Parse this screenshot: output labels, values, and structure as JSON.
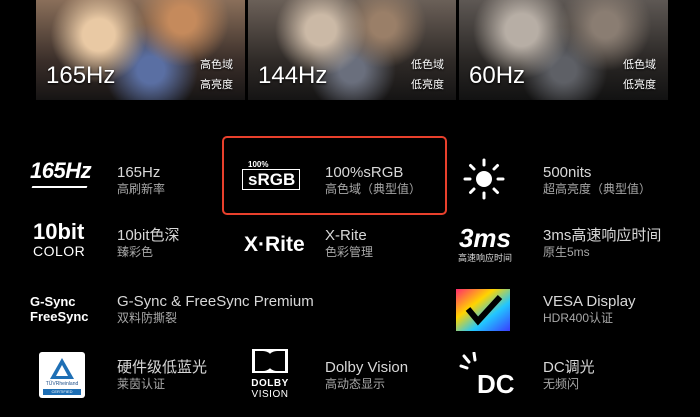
{
  "comparison": [
    {
      "hz": "165Hz",
      "tag1": "高色域",
      "tag2": "高亮度"
    },
    {
      "hz": "144Hz",
      "tag1": "低色域",
      "tag2": "低亮度"
    },
    {
      "hz": "60Hz",
      "tag1": "低色域",
      "tag2": "低亮度"
    }
  ],
  "features": {
    "hz165": {
      "logo": "165Hz",
      "title": "165Hz",
      "sub": "高刷新率"
    },
    "srgb": {
      "logo_top": "100%",
      "logo_main": "sRGB",
      "title": "100%sRGB",
      "sub": "高色域（典型值）"
    },
    "nits": {
      "title": "500nits",
      "sub": "超高亮度（典型值）",
      "icon": "sun-icon"
    },
    "bit10": {
      "logo_top": "10bit",
      "logo_bottom": "COLOR",
      "title": "10bit色深",
      "sub": "臻彩色"
    },
    "xrite": {
      "logo": "X·Rite",
      "title": "X-Rite",
      "sub": "色彩管理"
    },
    "ms3": {
      "logo": "3ms",
      "logo_sub": "高速响应时间",
      "title": "3ms高速响应时间",
      "sub": "原生5ms"
    },
    "gsync": {
      "logo_top": "G-Sync",
      "logo_bottom": "FreeSync",
      "title": "G-Sync & FreeSync Premium",
      "sub": "双料防撕裂"
    },
    "vesa": {
      "title": "VESA Display",
      "sub": "HDR400认证",
      "icon": "vesa-hdr-icon"
    },
    "tuv": {
      "logo_top": "TÜVRheinland",
      "logo_bottom": "CERTIFIED",
      "title": "硬件级低蓝光",
      "sub": "莱茵认证"
    },
    "dolby": {
      "logo_top": "DOLBY",
      "logo_bottom": "VISION",
      "title": "Dolby Vision",
      "sub": "高动态显示"
    },
    "dc": {
      "logo": "DC",
      "title": "DC调光",
      "sub": "无频闪"
    }
  },
  "colors": {
    "highlight": "#e8402c",
    "background": "#000000"
  }
}
